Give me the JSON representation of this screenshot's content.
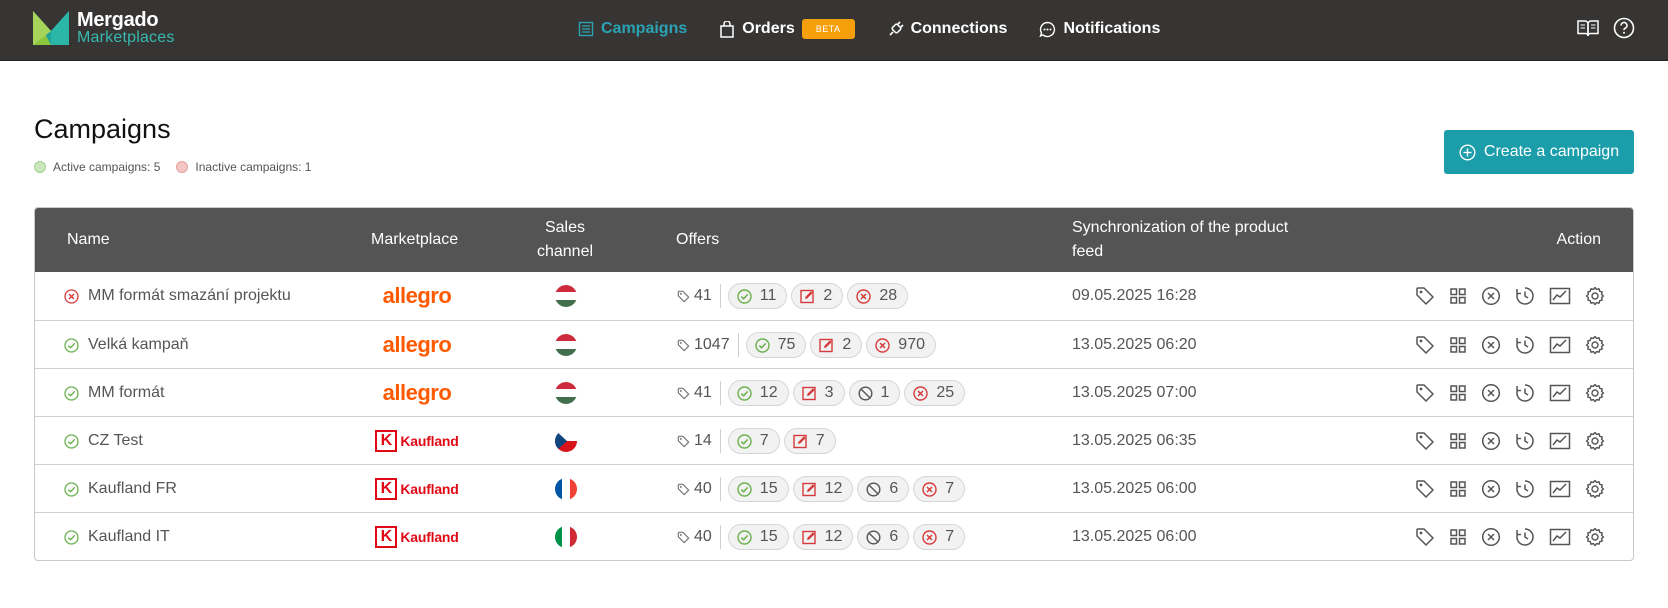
{
  "app": {
    "brand_line1": "Mergado",
    "brand_line2": "Marketplaces"
  },
  "nav": [
    {
      "label": "Campaigns",
      "icon": "list-icon",
      "active": true
    },
    {
      "label": "Orders",
      "icon": "shopping-bag-icon",
      "badge": "BETA"
    },
    {
      "label": "Connections",
      "icon": "plug-icon"
    },
    {
      "label": "Notifications",
      "icon": "chat-bubble-icon"
    }
  ],
  "header_icons": [
    "book-icon",
    "help-icon"
  ],
  "page": {
    "title": "Campaigns",
    "active_label": "Active campaigns: 5",
    "inactive_label": "Inactive campaigns: 1",
    "create_button": "Create a campaign"
  },
  "table": {
    "headers": {
      "name": "Name",
      "marketplace": "Marketplace",
      "sales_channel_1": "Sales",
      "sales_channel_2": "channel",
      "offers": "Offers",
      "sync_1": "Synchronization of the product",
      "sync_2": "feed",
      "action": "Action"
    },
    "rows": [
      {
        "status": "inactive",
        "name": "MM formát smazání projektu",
        "marketplace": "allegro",
        "flag": "hu",
        "total": "41",
        "ok": "11",
        "edited": "2",
        "blocked": null,
        "error": "28",
        "sync": "09.05.2025 16:28"
      },
      {
        "status": "active",
        "name": "Velká kampaň",
        "marketplace": "allegro",
        "flag": "hu",
        "total": "1047",
        "ok": "75",
        "edited": "2",
        "blocked": null,
        "error": "970",
        "sync": "13.05.2025 06:20"
      },
      {
        "status": "active",
        "name": "MM formát",
        "marketplace": "allegro",
        "flag": "hu",
        "total": "41",
        "ok": "12",
        "edited": "3",
        "blocked": "1",
        "error": "25",
        "sync": "13.05.2025 07:00"
      },
      {
        "status": "active",
        "name": "CZ Test",
        "marketplace": "kaufland",
        "flag": "cz",
        "total": "14",
        "ok": "7",
        "edited": "7",
        "blocked": null,
        "error": null,
        "sync": "13.05.2025 06:35"
      },
      {
        "status": "active",
        "name": "Kaufland FR",
        "marketplace": "kaufland",
        "flag": "fr",
        "total": "40",
        "ok": "15",
        "edited": "12",
        "blocked": "6",
        "error": "7",
        "sync": "13.05.2025 06:00"
      },
      {
        "status": "active",
        "name": "Kaufland IT",
        "marketplace": "kaufland",
        "flag": "it",
        "total": "40",
        "ok": "15",
        "edited": "12",
        "blocked": "6",
        "error": "7",
        "sync": "13.05.2025 06:00"
      }
    ],
    "marketplace_labels": {
      "allegro": "allegro",
      "kaufland": "Kaufland",
      "kaufland_mark": "K"
    },
    "action_icons": [
      "tag-icon",
      "grid-icon",
      "close-circle-icon",
      "history-icon",
      "chart-icon",
      "settings-icon"
    ]
  },
  "colors": {
    "topbar": "#373533",
    "accent": "#1b9daa",
    "beta": "#f59f0a",
    "active_green": "#6ab04c",
    "error_red": "#d63b3b",
    "allegro": "#ff5a00",
    "kaufland": "#e10915"
  }
}
